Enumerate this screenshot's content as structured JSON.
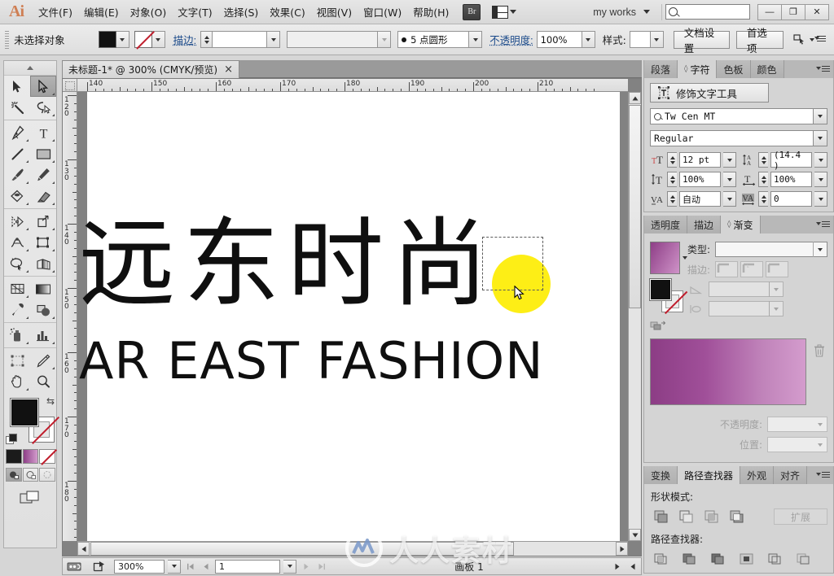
{
  "app": {
    "logo": "Ai",
    "menus": [
      "文件(F)",
      "编辑(E)",
      "对象(O)",
      "文字(T)",
      "选择(S)",
      "效果(C)",
      "视图(V)",
      "窗口(W)",
      "帮助(H)"
    ],
    "bridge_label": "Br",
    "arrange_icon": "arrange-documents-icon",
    "workspace": "my works",
    "search_placeholder": "",
    "window_buttons": [
      "—",
      "❐",
      "✕"
    ]
  },
  "control_bar": {
    "selection_status": "未选择对象",
    "fill_swatch_color": "#111111",
    "stroke_swatch": "none",
    "stroke_label": "描边:",
    "stroke_weight": "",
    "stroke_profile": "",
    "brush_def": "5 点圆形",
    "opacity_label": "不透明度:",
    "opacity_value": "100%",
    "style_label": "样式:",
    "doc_setup": "文档设置",
    "preferences": "首选项"
  },
  "toolbar": {
    "tools": [
      {
        "name": "selection-tool",
        "selected": false
      },
      {
        "name": "direct-selection-tool",
        "selected": true
      },
      {
        "name": "magic-wand-tool",
        "selected": false
      },
      {
        "name": "lasso-tool",
        "selected": false
      },
      {
        "name": "pen-tool",
        "selected": false
      },
      {
        "name": "type-tool",
        "selected": false
      },
      {
        "name": "line-segment-tool",
        "selected": false
      },
      {
        "name": "rectangle-tool",
        "selected": false
      },
      {
        "name": "paintbrush-tool",
        "selected": false
      },
      {
        "name": "pencil-tool",
        "selected": false
      },
      {
        "name": "blob-brush-tool",
        "selected": false
      },
      {
        "name": "eraser-tool",
        "selected": false
      },
      {
        "name": "rotate-tool",
        "selected": false
      },
      {
        "name": "scale-tool",
        "selected": false
      },
      {
        "name": "width-tool",
        "selected": false
      },
      {
        "name": "free-transform-tool",
        "selected": false
      },
      {
        "name": "shape-builder-tool",
        "selected": false
      },
      {
        "name": "perspective-grid-tool",
        "selected": false
      },
      {
        "name": "mesh-tool",
        "selected": false
      },
      {
        "name": "gradient-tool",
        "selected": false
      },
      {
        "name": "eyedropper-tool",
        "selected": false
      },
      {
        "name": "blend-tool",
        "selected": false
      },
      {
        "name": "symbol-sprayer-tool",
        "selected": false
      },
      {
        "name": "column-graph-tool",
        "selected": false
      },
      {
        "name": "artboard-tool",
        "selected": false
      },
      {
        "name": "slice-tool",
        "selected": false
      },
      {
        "name": "hand-tool",
        "selected": false
      },
      {
        "name": "zoom-tool",
        "selected": false
      }
    ],
    "fill_color": "#111111",
    "stroke_color": "none",
    "swap_icon": "swap-fill-stroke-icon",
    "default_icon": "default-fill-stroke-icon",
    "paint_modes": [
      "solid-color",
      "gradient",
      "none"
    ],
    "screen_modes": [
      "normal-screen-mode",
      "full-screen-with-menu",
      "full-screen"
    ],
    "change_screen_icon": "change-screen-mode-icon"
  },
  "document": {
    "tab_title": "未标题-1* @ 300% (CMYK/预览)",
    "close_icon": "×"
  },
  "rulers": {
    "horizontal": [
      "140",
      "150",
      "160",
      "170",
      "180",
      "190",
      "200",
      "210"
    ],
    "vertical": [
      "120",
      "130",
      "140",
      "150",
      "160",
      "170",
      "180"
    ],
    "unit": "mm"
  },
  "artwork": {
    "chinese_title": "远东时尚",
    "english_title": "AR EAST FASHION",
    "highlight_color": "#fdee16",
    "text_color": "#0f0f0f",
    "selection_marquee": "dashed-selection-rect",
    "cursor": "arrow-cursor"
  },
  "status_bar": {
    "zoom": "300%",
    "page": "1",
    "artboard_label": "画板 1",
    "icons": [
      "adobe-drive-icon",
      "share-icon",
      "first-page-icon",
      "prev-page-icon",
      "next-page-icon",
      "last-page-icon"
    ]
  },
  "panels": {
    "character": {
      "tabs": [
        {
          "label": "段落",
          "active": false
        },
        {
          "label": "字符",
          "active": true
        },
        {
          "label": "色板",
          "active": false
        },
        {
          "label": "颜色",
          "active": false
        }
      ],
      "touch_type_button": "修饰文字工具",
      "font_family": "Tw Cen MT",
      "font_style": "Regular",
      "font_size": "12 pt",
      "leading": "(14.4 )",
      "vertical_scale": "100%",
      "horizontal_scale": "100%",
      "kerning": "自动",
      "tracking": "0",
      "icon_font_size": "font-size-icon",
      "icon_leading": "leading-icon",
      "icon_vscale": "vertical-scale-icon",
      "icon_hscale": "horizontal-scale-icon",
      "icon_kerning": "kerning-icon",
      "icon_tracking": "tracking-icon"
    },
    "gradient": {
      "tabs": [
        {
          "label": "透明度",
          "active": false
        },
        {
          "label": "描边",
          "active": false
        },
        {
          "label": "渐变",
          "active": true
        }
      ],
      "type_label": "类型:",
      "type_value": "",
      "stroke_label": "描边:",
      "angle_value": "",
      "aspect_value": "",
      "opacity_label": "不透明度:",
      "opacity_value": "",
      "location_label": "位置:",
      "location_value": "",
      "gradient_start": "#8c3d85",
      "gradient_end": "#d49ccd",
      "delete_stop_icon": "trash-icon"
    },
    "pathfinder": {
      "tabs": [
        {
          "label": "变换",
          "active": false
        },
        {
          "label": "路径查找器",
          "active": true
        },
        {
          "label": "外观",
          "active": false
        },
        {
          "label": "对齐",
          "active": false
        }
      ],
      "shape_modes_label": "形状模式:",
      "shape_modes": [
        "unite-icon",
        "minus-front-icon",
        "intersect-icon",
        "exclude-icon"
      ],
      "expand_button": "扩展",
      "pathfinders_label": "路径查找器:",
      "pathfinders": [
        "divide-icon",
        "trim-icon",
        "merge-icon",
        "crop-icon",
        "outline-icon",
        "minus-back-icon"
      ]
    }
  },
  "watermark": {
    "text": "人人素材",
    "logo": "renren-sucai-logo"
  }
}
